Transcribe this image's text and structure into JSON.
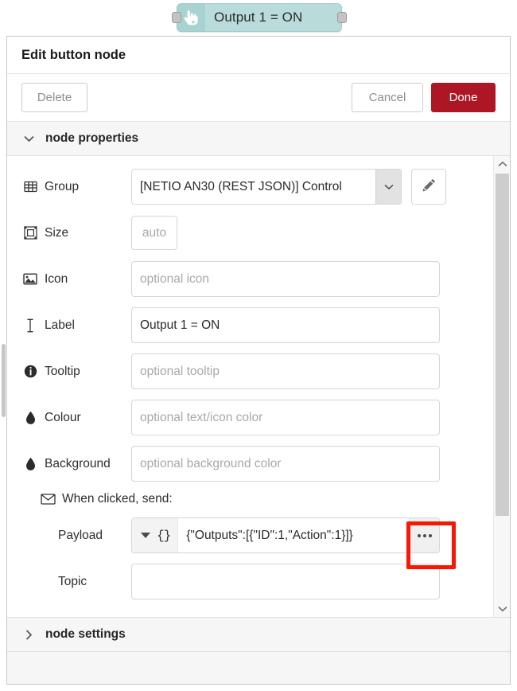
{
  "node_chip": {
    "label": "Output 1 = ON",
    "icon": "pointing-hand-icon",
    "fill_color": "#b9dcdb",
    "icon_box_color": "#a9d3d2"
  },
  "dialog": {
    "title": "Edit button node",
    "toolbar": {
      "delete_label": "Delete",
      "cancel_label": "Cancel",
      "done_label": "Done",
      "done_color": "#ad1625"
    },
    "sections": {
      "properties": {
        "label": "node properties",
        "expanded": true,
        "chevron": "chevron-down-icon"
      },
      "settings": {
        "label": "node settings",
        "expanded": false,
        "chevron": "chevron-right-icon"
      }
    },
    "fields": {
      "group": {
        "label": "Group",
        "icon": "table-grid-icon",
        "value": "[NETIO AN30 (REST JSON)] Control ",
        "edit_button_icon": "pencil-icon"
      },
      "size": {
        "label": "Size",
        "icon": "resize-frame-icon",
        "value": "",
        "placeholder": "auto"
      },
      "icon": {
        "label": "Icon",
        "icon": "image-icon",
        "value": "",
        "placeholder": "optional icon"
      },
      "label": {
        "label": "Label",
        "icon": "text-cursor-icon",
        "value": "Output 1 = ON",
        "placeholder": ""
      },
      "tooltip": {
        "label": "Tooltip",
        "icon": "info-circle-icon",
        "value": "",
        "placeholder": "optional tooltip"
      },
      "colour": {
        "label": "Colour",
        "icon": "droplet-icon",
        "value": "",
        "placeholder": "optional text/icon color"
      },
      "background": {
        "label": "Background",
        "icon": "droplet-icon",
        "value": "",
        "placeholder": "optional background color"
      }
    },
    "when_clicked": {
      "heading": "When clicked, send:",
      "icon": "envelope-icon",
      "payload": {
        "label": "Payload",
        "type_glyph": "{}",
        "type_name": "JSON",
        "value": "{\"Outputs\":[{\"ID\":1,\"Action\":1}]}",
        "expand_icon": "ellipsis-icon"
      },
      "topic": {
        "label": "Topic",
        "value": "",
        "placeholder": ""
      }
    },
    "highlight": {
      "color": "#f81705",
      "target": "payload-expand-button"
    },
    "scrollbar": {
      "up_icon": "chevron-up-icon",
      "down_icon": "chevron-down-icon"
    }
  }
}
